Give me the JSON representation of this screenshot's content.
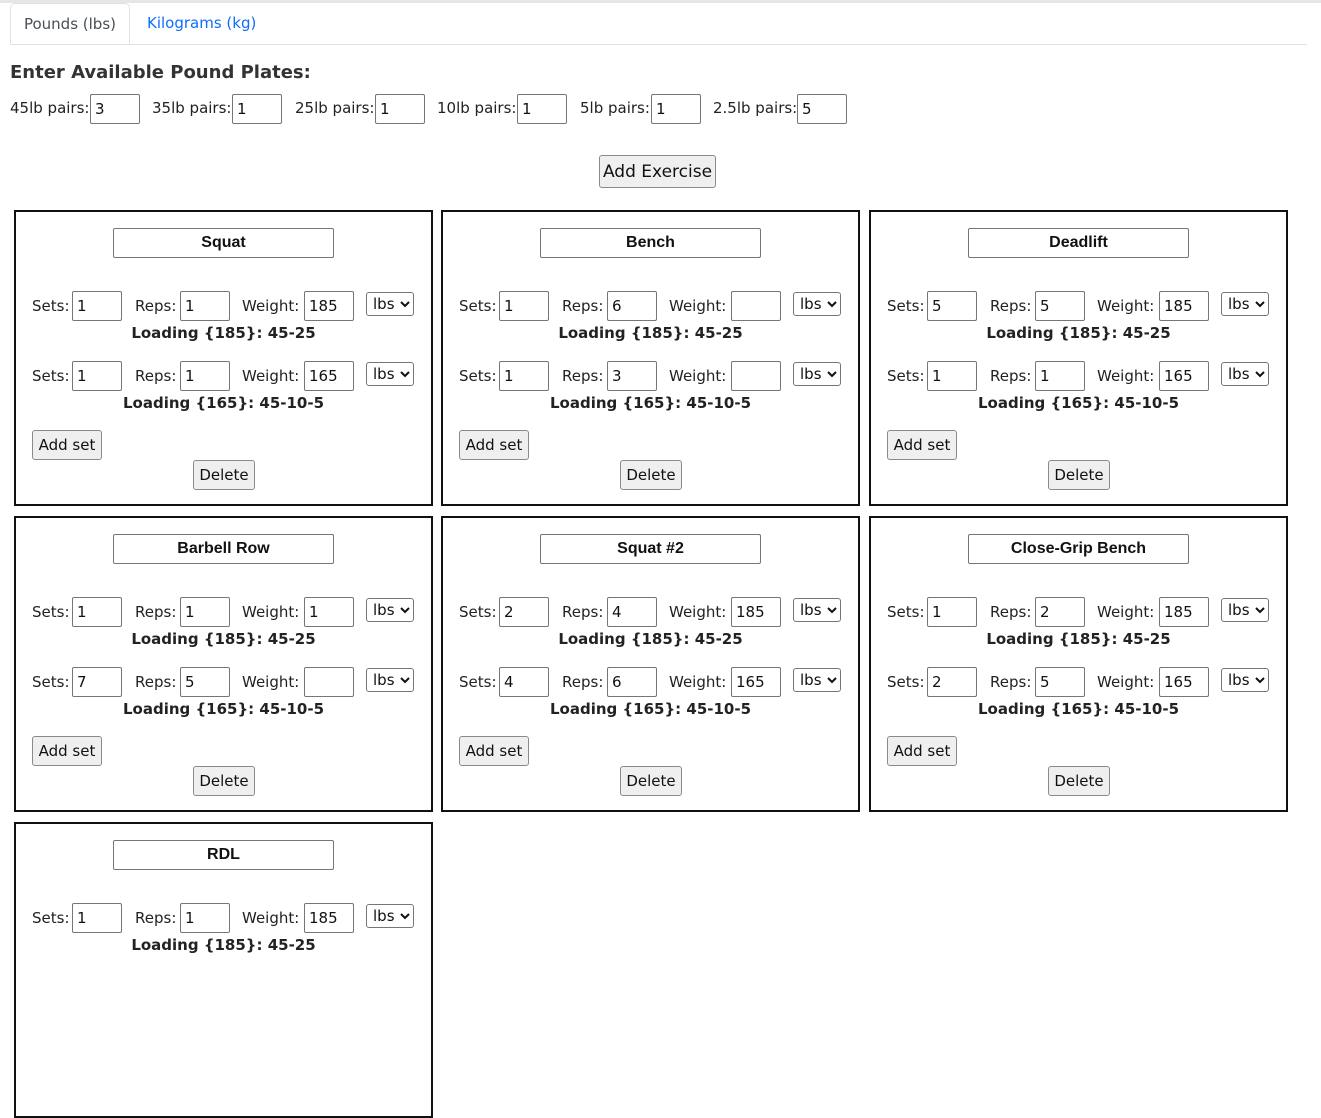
{
  "tabs": [
    {
      "label": "Pounds (lbs)",
      "active": true
    },
    {
      "label": "Kilograms (kg)",
      "active": false
    }
  ],
  "plates": {
    "title": "Enter Available Pound Plates:",
    "items": [
      {
        "label": "45lb pairs:",
        "value": "3"
      },
      {
        "label": "35lb pairs:",
        "value": "1"
      },
      {
        "label": "25lb pairs:",
        "value": "1"
      },
      {
        "label": "10lb pairs:",
        "value": "1"
      },
      {
        "label": "5lb pairs:",
        "value": "1"
      },
      {
        "label": "2.5lb pairs:",
        "value": "5"
      }
    ]
  },
  "labels": {
    "add_exercise": "Add Exercise",
    "sets": "Sets:",
    "reps": "Reps:",
    "weight": "Weight:",
    "unit": "lbs",
    "add_set": "Add set",
    "delete": "Delete"
  },
  "exercises": [
    {
      "name": "Squat",
      "sets": [
        {
          "sets": "1",
          "reps": "1",
          "weight": "185",
          "unit": "lbs",
          "loading": "Loading {185}: 45-25"
        },
        {
          "sets": "1",
          "reps": "1",
          "weight": "165",
          "unit": "lbs",
          "loading": "Loading {165}: 45-10-5"
        }
      ]
    },
    {
      "name": "Bench",
      "sets": [
        {
          "sets": "1",
          "reps": "6",
          "weight": "",
          "unit": "lbs",
          "loading": "Loading {185}: 45-25"
        },
        {
          "sets": "1",
          "reps": "3",
          "weight": "",
          "unit": "lbs",
          "loading": "Loading {165}: 45-10-5"
        }
      ]
    },
    {
      "name": "Deadlift",
      "sets": [
        {
          "sets": "5",
          "reps": "5",
          "weight": "185",
          "unit": "lbs",
          "loading": "Loading {185}: 45-25"
        },
        {
          "sets": "1",
          "reps": "1",
          "weight": "165",
          "unit": "lbs",
          "loading": "Loading {165}: 45-10-5"
        }
      ]
    },
    {
      "name": "Barbell Row",
      "sets": [
        {
          "sets": "1",
          "reps": "1",
          "weight": "1",
          "unit": "lbs",
          "loading": "Loading {185}: 45-25"
        },
        {
          "sets": "7",
          "reps": "5",
          "weight": "",
          "unit": "lbs",
          "loading": "Loading {165}: 45-10-5"
        }
      ]
    },
    {
      "name": "Squat #2",
      "sets": [
        {
          "sets": "2",
          "reps": "4",
          "weight": "185",
          "unit": "lbs",
          "loading": "Loading {185}: 45-25"
        },
        {
          "sets": "4",
          "reps": "6",
          "weight": "165",
          "unit": "lbs",
          "loading": "Loading {165}: 45-10-5"
        }
      ]
    },
    {
      "name": "Close-Grip Bench",
      "sets": [
        {
          "sets": "1",
          "reps": "2",
          "weight": "185",
          "unit": "lbs",
          "loading": "Loading {185}: 45-25"
        },
        {
          "sets": "2",
          "reps": "5",
          "weight": "165",
          "unit": "lbs",
          "loading": "Loading {165}: 45-10-5"
        }
      ]
    },
    {
      "name": "RDL",
      "sets": [
        {
          "sets": "1",
          "reps": "1",
          "weight": "185",
          "unit": "lbs",
          "loading": "Loading {185}: 45-25"
        }
      ]
    }
  ]
}
